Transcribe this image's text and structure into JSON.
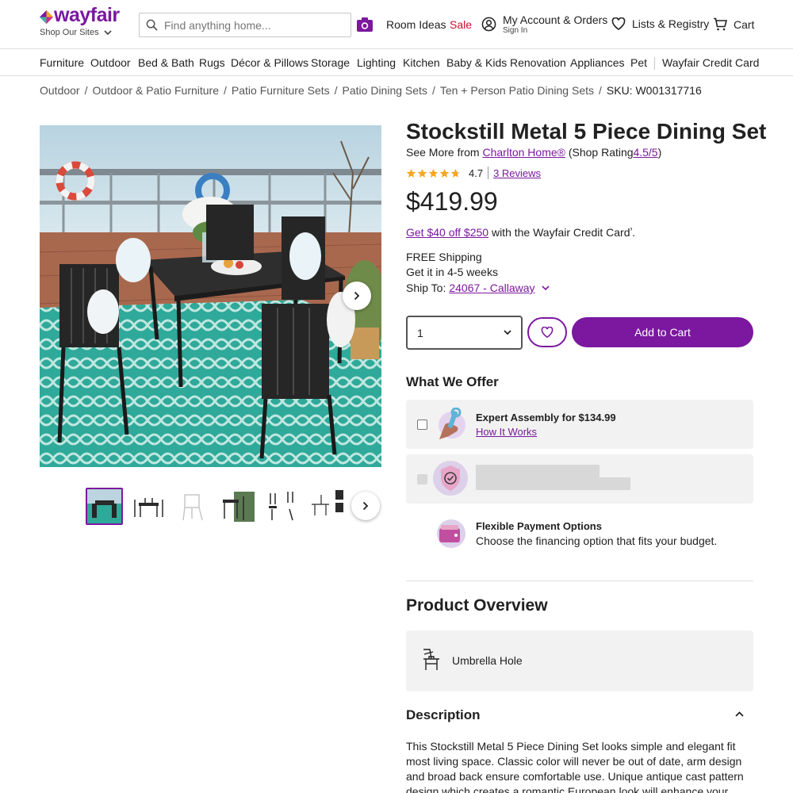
{
  "header": {
    "logo_text": "wayfair",
    "shop_sites": "Shop Our Sites",
    "search_placeholder": "Find anything home...",
    "room_ideas": "Room Ideas",
    "sale": "Sale",
    "account_title": "My Account & Orders",
    "account_sub": "Sign In",
    "lists": "Lists & Registry",
    "cart": "Cart"
  },
  "nav": {
    "items": [
      "Furniture",
      "Outdoor",
      "Bed & Bath",
      "Rugs",
      "Décor & Pillows",
      "Storage",
      "Lighting",
      "Kitchen",
      "Baby & Kids",
      "Renovation",
      "Appliances",
      "Pet",
      "Wayfair Credit Card"
    ]
  },
  "breadcrumb": {
    "items": [
      "Outdoor",
      "Outdoor & Patio Furniture",
      "Patio Furniture Sets",
      "Patio Dining Sets",
      "Ten + Person Patio Dining Sets"
    ],
    "separator": "/",
    "sku": "SKU: W001317716"
  },
  "product": {
    "title": "Stockstill Metal 5 Piece Dining Set",
    "see_more_prefix": "See More from",
    "brand": "Charlton Home®",
    "shop_rating_prefix": "(Shop Rating",
    "shop_rating": "4.5/5",
    "shop_rating_suffix": ")",
    "rating": "4.7",
    "rating_value": 4.7,
    "reviews": "3 Reviews",
    "price": "$419.99",
    "credit_link": "Get $40 off $250",
    "credit_text": "with the Wayfair Credit Card",
    "credit_sup": "³",
    "credit_end": ".",
    "shipping": "FREE Shipping",
    "delivery": "Get it in 4-5 weeks",
    "ship_to_label": "Ship To:",
    "ship_to_value": "24067 - Callaway",
    "quantity": "1",
    "add_to_cart": "Add to Cart"
  },
  "offers": {
    "heading": "What We Offer",
    "assembly_title": "Expert Assembly for $134.99",
    "assembly_link": "How It Works",
    "payment_title": "Flexible Payment Options",
    "payment_sub": "Choose the financing option that fits your budget."
  },
  "overview": {
    "heading": "Product Overview",
    "feature": "Umbrella Hole"
  },
  "description": {
    "heading": "Description",
    "text": "This Stockstill Metal 5 Piece Dining Set looks simple and elegant fit most living space. Classic color will never be out of date, arm design and broad back ensure comfortable use. Unique antique cast pattern design which creates a romantic European look will enhance your outdoor living space."
  },
  "colors": {
    "brand": "#7b189f",
    "sale": "#c8102e",
    "star": "#f5a623"
  }
}
